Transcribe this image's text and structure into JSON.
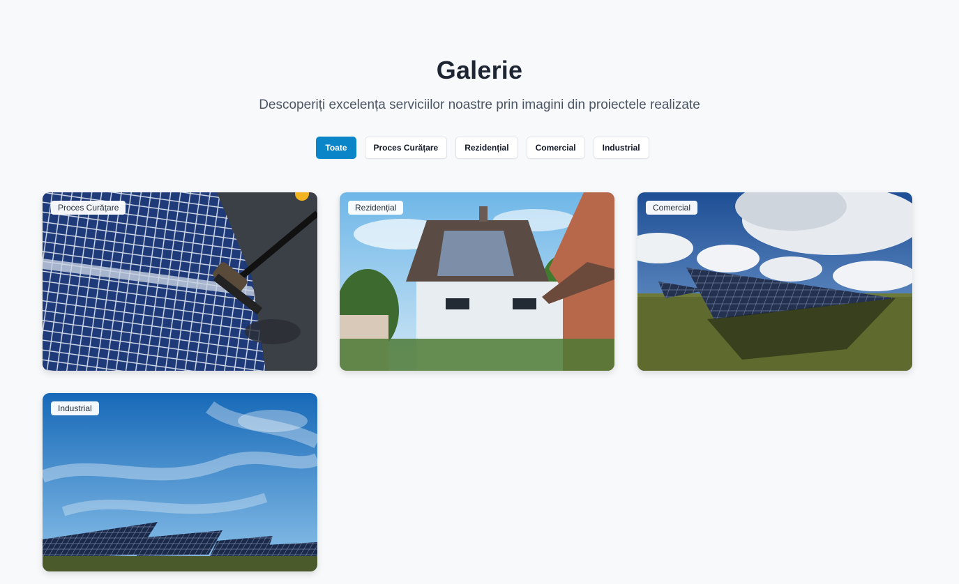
{
  "header": {
    "title": "Galerie",
    "subtitle": "Descoperiți excelența serviciilor noastre prin imagini din proiectele realizate"
  },
  "filters": [
    {
      "label": "Toate",
      "active": true
    },
    {
      "label": "Proces Curățare",
      "active": false
    },
    {
      "label": "Rezidențial",
      "active": false
    },
    {
      "label": "Comercial",
      "active": false
    },
    {
      "label": "Industrial",
      "active": false
    }
  ],
  "gallery": [
    {
      "category": "Proces Curățare",
      "image": "solar-panel-cleaning-brush-photo"
    },
    {
      "category": "Rezidențial",
      "image": "house-with-rooftop-solar-photo"
    },
    {
      "category": "Comercial",
      "image": "solar-farm-field-cloudy-sky-photo"
    },
    {
      "category": "Industrial",
      "image": "solar-farm-blue-sky-photo"
    }
  ],
  "colors": {
    "accent": "#0a86c8",
    "background": "#f7f9fb",
    "title": "#1e2633",
    "subtitle": "#4b5563"
  }
}
